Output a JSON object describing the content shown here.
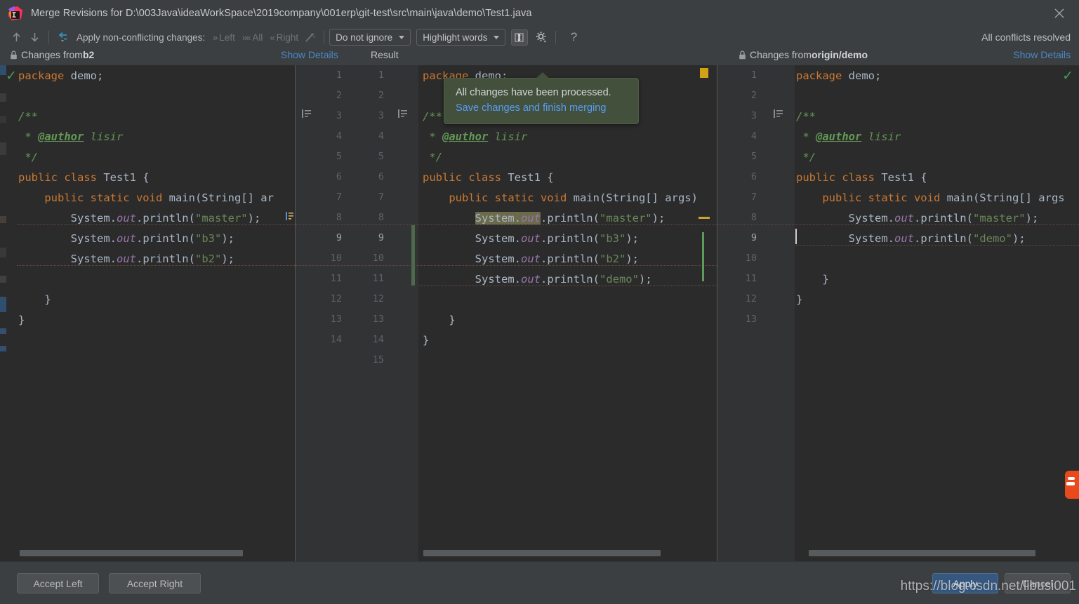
{
  "window": {
    "title": "Merge Revisions for D:\\003Java\\ideaWorkSpace\\2019company\\001erp\\git-test\\src\\main\\java\\demo\\Test1.java",
    "logo_icon": "intellij-idea-logo-icon",
    "close_icon": "close-icon"
  },
  "toolbar": {
    "prev_icon": "arrow-up-icon",
    "next_icon": "arrow-down-icon",
    "apply_all_icon": "apply-all-changes-icon",
    "apply_label": "Apply non-conflicting changes:",
    "left_label": "Left",
    "all_label": "All",
    "right_label": "Right",
    "magic_icon": "magic-wand-icon",
    "ignore_policy": "Do not ignore",
    "highlight_policy": "Highlight words",
    "collapse_icon": "collapse-unchanged-icon",
    "gear_icon": "gear-icon",
    "help_label": "?",
    "conflicts_status": "All conflicts resolved"
  },
  "headers": {
    "left": {
      "lock_icon": "lock-icon",
      "prefix": "Changes from ",
      "branch": "b2",
      "details": "Show Details"
    },
    "center": {
      "title": "Result"
    },
    "right": {
      "lock_icon": "lock-icon",
      "prefix": "Changes from ",
      "branch": "origin/demo",
      "details": "Show Details"
    }
  },
  "tooltip": {
    "message": "All changes have been processed.",
    "action": "Save changes and finish merging"
  },
  "left_pane": {
    "lines": [
      "package demo;",
      "",
      "/**",
      " * @author lisir",
      " */",
      "public class Test1 {",
      "    public static void main(String[] ar",
      "        System.out.println(\"master\");",
      "        System.out.println(\"b3\");",
      "        System.out.println(\"b2\");",
      "",
      "    }",
      "}"
    ]
  },
  "center_pane": {
    "line_numbers_left": [
      "1",
      "2",
      "3",
      "4",
      "5",
      "6",
      "7",
      "8",
      "9",
      "10",
      "11",
      "12",
      "13",
      "14"
    ],
    "line_numbers_right": [
      "1",
      "2",
      "3",
      "4",
      "5",
      "6",
      "7",
      "8",
      "9",
      "10",
      "11",
      "12",
      "13",
      "14",
      "15"
    ],
    "active_line": "9",
    "lines": [
      "package demo;",
      "",
      "/**",
      " * @author lisir",
      " */",
      "public class Test1 {",
      "    public static void main(String[] args)",
      "        System.out.println(\"master\");",
      "        System.out.println(\"b3\");",
      "        System.out.println(\"b2\");",
      "        System.out.println(\"demo\");",
      "",
      "    }",
      "}"
    ]
  },
  "right_pane": {
    "line_numbers": [
      "1",
      "2",
      "3",
      "4",
      "5",
      "6",
      "7",
      "8",
      "9",
      "10",
      "11",
      "12",
      "13"
    ],
    "lines": [
      "package demo;",
      "",
      "/**",
      " * @author lisir",
      " */",
      "public class Test1 {",
      "    public static void main(String[] args",
      "        System.out.println(\"master\");",
      "        System.out.println(\"demo\");",
      "",
      "    }",
      "}"
    ]
  },
  "buttons": {
    "accept_left": "Accept Left",
    "accept_right": "Accept Right",
    "apply": "Apply",
    "cancel": "Cancel"
  },
  "watermark": "https://blog.csdn.net/libusi001",
  "colors": {
    "background": "#3c3f41",
    "editor_background": "#2b2b2b",
    "gutter": "#313335",
    "link": "#4a88c7",
    "accent_primary": "#365880",
    "tooltip_bg": "#42503c",
    "keyword": "#cc7832",
    "string": "#6a8759",
    "comment": "#629755",
    "field": "#9876aa",
    "text": "#a9b7c6",
    "change_bar": "#4e6a4c",
    "marker_yellow": "#d4a017"
  }
}
